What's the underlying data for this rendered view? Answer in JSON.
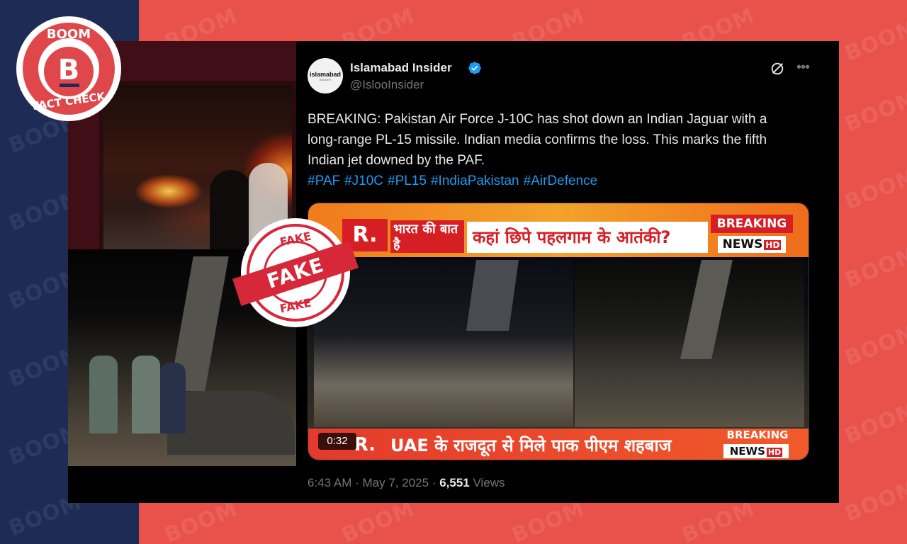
{
  "brand": {
    "logo_top": "BOOM",
    "logo_letter": "B",
    "logo_bottom": "FACT CHECK",
    "watermark": "BOOM",
    "colors": {
      "red": "#e9514b",
      "navy": "#1e2c55"
    }
  },
  "stamp": {
    "small_top": "FAKE",
    "main": "FAKE",
    "small_bottom": "FAKE",
    "color": "#d7283a"
  },
  "tweet": {
    "avatar_text": "islamabad",
    "avatar_sub": "INSIDER",
    "display_name": "Islamabad Insider",
    "handle": "@IslooInsider",
    "text": "BREAKING: Pakistan Air Force J-10C has shot down an Indian Jaguar with a long-range PL-15 missile. Indian media confirms the loss. This marks the fifth Indian jet downed by the PAF.",
    "hashtags": [
      "#PAF",
      "#J10C",
      "#PL15",
      "#IndiaPakistan",
      "#AirDefence"
    ],
    "time": "6:43 AM",
    "date": "May 7, 2025",
    "views_count": "6,551",
    "views_label": "Views"
  },
  "video": {
    "r_logo": "R.",
    "show_name_hindi": "भारत की बात है",
    "headline_top": "कहां छिपे पहलगाम के आतंकी?",
    "breaking_label": "BREAKING",
    "news_label": "NEWS",
    "hd_label": "HD",
    "headline_bottom": "UAE के राजदूत से मिले पाक पीएम शहबाज",
    "duration": "0:32"
  }
}
